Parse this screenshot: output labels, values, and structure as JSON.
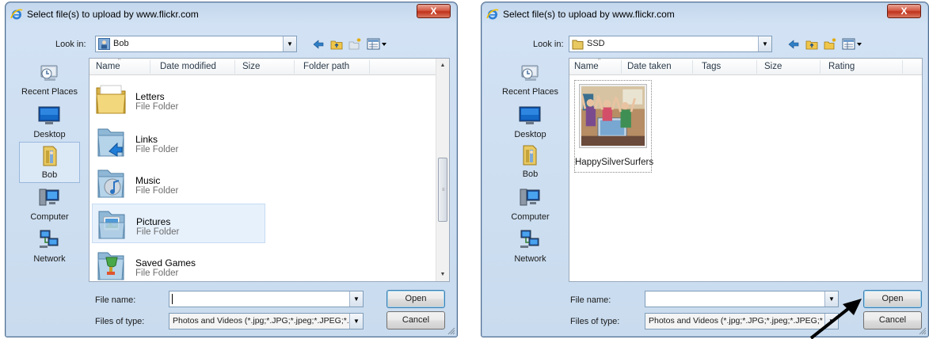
{
  "left_dialog": {
    "title": "Select file(s) to upload by www.flickr.com",
    "close_label": "X",
    "look_in_label": "Look in:",
    "look_in_value": "Bob",
    "places": [
      {
        "label": "Recent Places",
        "icon": "recent-places-icon"
      },
      {
        "label": "Desktop",
        "icon": "desktop-icon"
      },
      {
        "label": "Bob",
        "icon": "user-folder-icon",
        "selected": true
      },
      {
        "label": "Computer",
        "icon": "computer-icon"
      },
      {
        "label": "Network",
        "icon": "network-icon"
      }
    ],
    "columns": [
      "Name",
      "Date modified",
      "Size",
      "Folder path"
    ],
    "files": [
      {
        "name": "Letters",
        "type": "File Folder",
        "icon": "folder-icon"
      },
      {
        "name": "Links",
        "type": "File Folder",
        "icon": "links-folder-icon"
      },
      {
        "name": "Music",
        "type": "File Folder",
        "icon": "music-folder-icon"
      },
      {
        "name": "Pictures",
        "type": "File Folder",
        "icon": "pictures-folder-icon",
        "selected": true
      },
      {
        "name": "Saved Games",
        "type": "File Folder",
        "icon": "saved-games-folder-icon"
      }
    ],
    "file_name_label": "File name:",
    "file_name_value": "",
    "file_type_label": "Files of type:",
    "file_type_value": "Photos and Videos (*.jpg;*.JPG;*.jpeg;*.JPEG;*.",
    "open_label": "Open",
    "cancel_label": "Cancel"
  },
  "right_dialog": {
    "title": "Select file(s) to upload by www.flickr.com",
    "close_label": "X",
    "look_in_label": "Look in:",
    "look_in_value": "SSD",
    "places": [
      {
        "label": "Recent Places",
        "icon": "recent-places-icon"
      },
      {
        "label": "Desktop",
        "icon": "desktop-icon"
      },
      {
        "label": "Bob",
        "icon": "user-folder-icon"
      },
      {
        "label": "Computer",
        "icon": "computer-icon"
      },
      {
        "label": "Network",
        "icon": "network-icon"
      }
    ],
    "columns": [
      "Name",
      "Date taken",
      "Tags",
      "Size",
      "Rating"
    ],
    "thumbnail": {
      "name": "HappySilverSurfers"
    },
    "file_name_label": "File name:",
    "file_name_value": "",
    "file_type_label": "Files of type:",
    "file_type_value": "Photos and Videos (*.jpg;*.JPG;*.jpeg;*.JPEG;*.",
    "open_label": "Open",
    "cancel_label": "Cancel"
  },
  "colors": {
    "title_gradient_top": "#c3d6ec",
    "close_red": "#c1321c",
    "selection_blue": "#e7f1fc",
    "annotation_arrow": "#000000"
  }
}
